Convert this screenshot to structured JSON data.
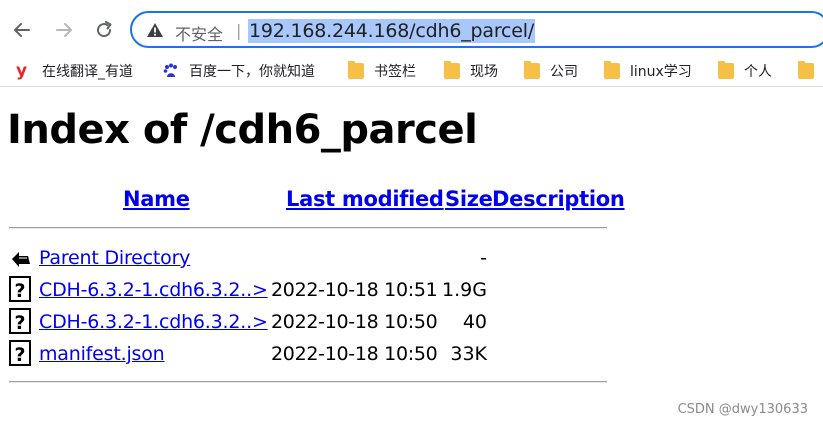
{
  "browser": {
    "nav": {
      "back_icon": "arrow-left-icon",
      "forward_icon": "arrow-right-icon",
      "reload_icon": "reload-icon"
    },
    "address_bar": {
      "security_icon": "warning-triangle-icon",
      "security_label": "不安全",
      "separator": "|",
      "url": "192.168.244.168/cdh6_parcel/"
    },
    "bookmarks": [
      {
        "label": "在线翻译_有道",
        "icon": "youdao-icon"
      },
      {
        "label": "百度一下，你就知道",
        "icon": "baidu-paw-icon"
      },
      {
        "label": "书签栏",
        "icon": "folder-icon"
      },
      {
        "label": "现场",
        "icon": "folder-icon"
      },
      {
        "label": "公司",
        "icon": "folder-icon"
      },
      {
        "label": "linux学习",
        "icon": "folder-icon"
      },
      {
        "label": "个人",
        "icon": "folder-icon"
      },
      {
        "label": "",
        "icon": "folder-icon"
      }
    ]
  },
  "page": {
    "title": "Index of /cdh6_parcel",
    "columns": {
      "name": "Name",
      "last_modified": "Last modified",
      "size": "Size",
      "description": "Description"
    },
    "rows": [
      {
        "icon": "back-arrow-icon",
        "name": "Parent Directory",
        "date": "",
        "size": "-"
      },
      {
        "icon": "unknown-file-icon",
        "name": "CDH-6.3.2-1.cdh6.3.2..>",
        "date": "2022-10-18 10:51",
        "size": "1.9G"
      },
      {
        "icon": "unknown-file-icon",
        "name": "CDH-6.3.2-1.cdh6.3.2..>",
        "date": "2022-10-18 10:50",
        "size": "40"
      },
      {
        "icon": "unknown-file-icon",
        "name": "manifest.json",
        "date": "2022-10-18 10:50",
        "size": "33K"
      }
    ]
  },
  "watermark": "CSDN @dwy130633",
  "colors": {
    "link": "#0000ee",
    "url_highlight": "#a8c7fa",
    "omnibox_border": "#1a73e8",
    "folder": "#f6c046"
  }
}
